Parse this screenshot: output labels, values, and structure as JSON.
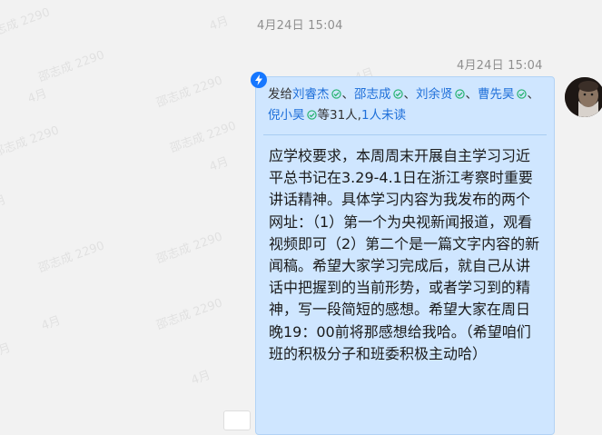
{
  "watermark_texts": [
    "邵志成 2290",
    "4月",
    "邵志成 2290",
    "4月",
    "邵志成 2290",
    "4月",
    "邵志成 2290",
    "4月",
    "邵志成 2290",
    "4月",
    "邵志成 2290",
    "4月",
    "邵志成 2290",
    "4月",
    "邵志成 2290",
    "4月"
  ],
  "timestamps": {
    "first": "4月24日 15:04",
    "second": "4月24日 15:04"
  },
  "message": {
    "recipients_prefix": "发给",
    "recipients": [
      {
        "name": "刘睿杰",
        "separator": "、"
      },
      {
        "name": "邵志成",
        "separator": "、"
      },
      {
        "name": "刘余贤",
        "separator": "、"
      },
      {
        "name": "曹先昊",
        "separator": "、"
      },
      {
        "name": "倪小昊",
        "separator": ""
      }
    ],
    "count_text": "等31人,",
    "unread_text": "1人未读",
    "body": "应学校要求，本周周末开展自主学习习近平总书记在3.29-4.1日在浙江考察时重要讲话精神。具体学习内容为我发布的两个网址：（1）第一个为央视新闻报道，观看视频即可（2）第二个是一篇文字内容的新闻稿。希望大家学习完成后，就自己从讲话中把握到的当前形势，或者学习到的精神，写一段简短的感想。希望大家在周日晚19：00前将那感想给我哈。（希望咱们班的积极分子和班委积极主动哈）"
  },
  "colors": {
    "bubble_bg": "#cfe6ff",
    "name_link": "#1e6fd9",
    "check_green": "#23b26d",
    "ding_blue": "#1677ff"
  },
  "icons": {
    "ding": "flash-icon",
    "read_check": "check-circle-icon"
  }
}
